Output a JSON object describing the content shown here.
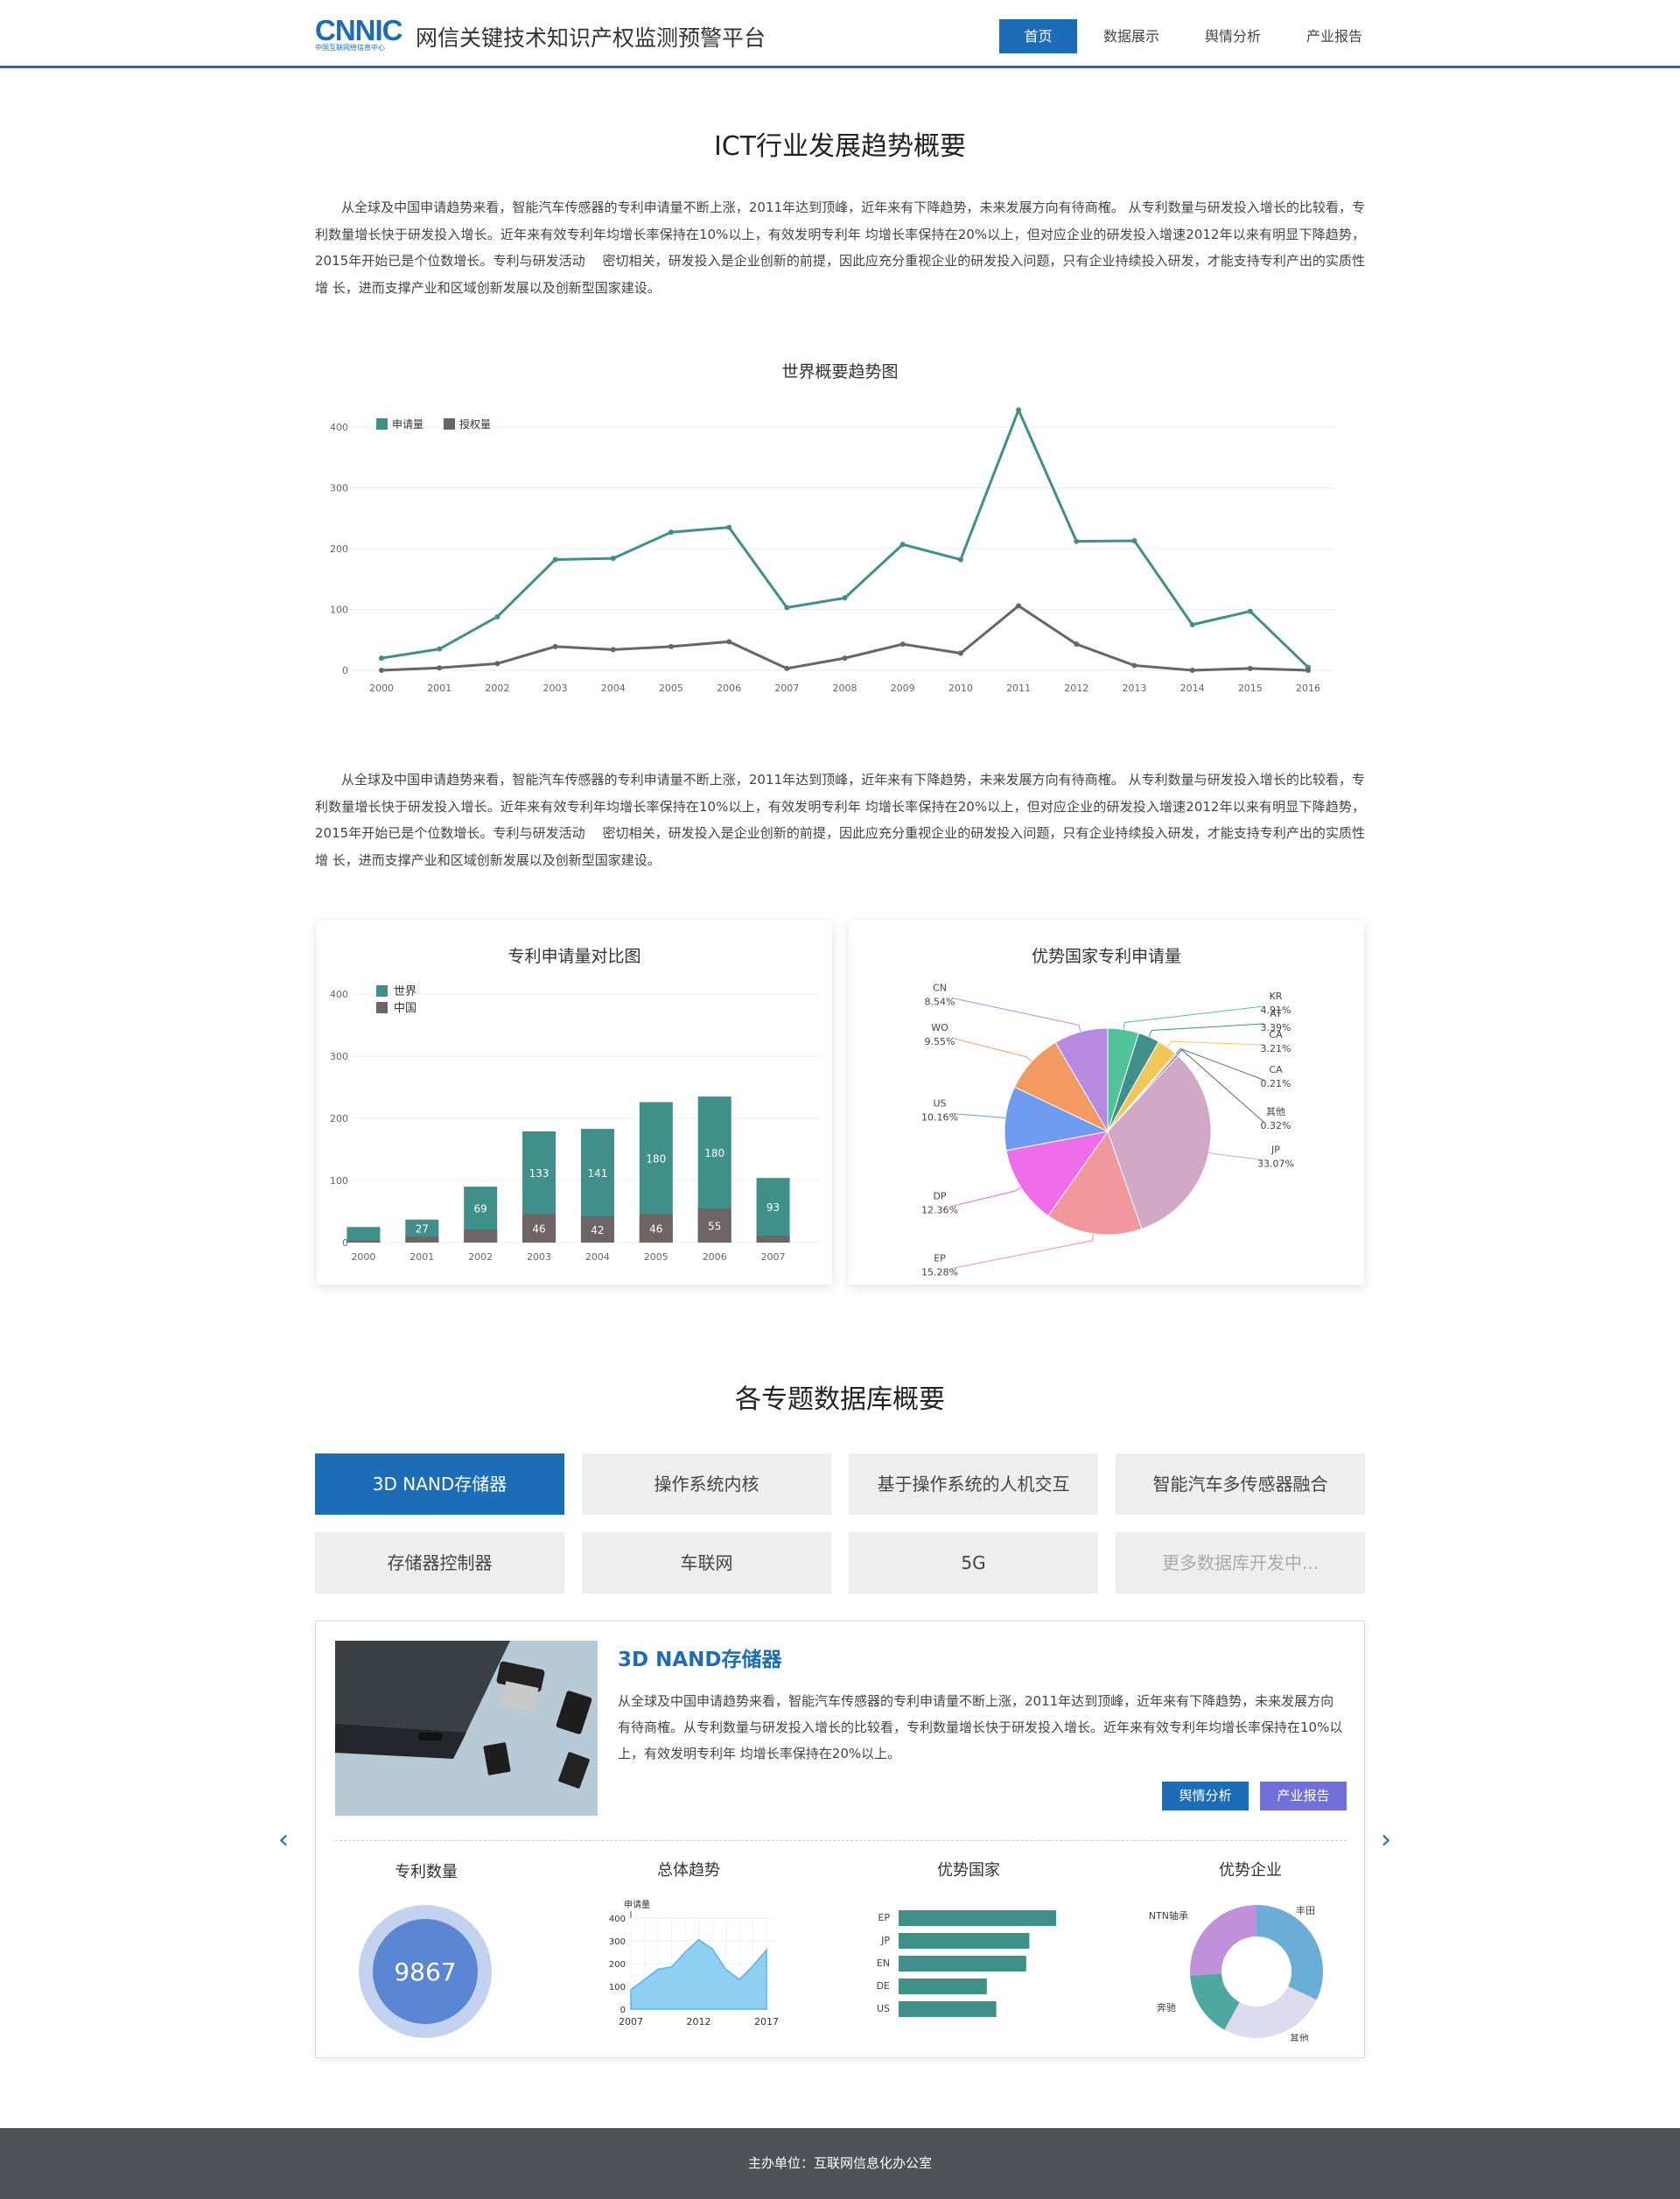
{
  "header": {
    "logo_text": "CNNIC",
    "logo_sub": "中国互联网络信息中心",
    "site_title": "网信关键技术知识产权监测预警平台",
    "nav": [
      "首页",
      "数据展示",
      "舆情分析",
      "产业报告"
    ]
  },
  "overview": {
    "title": "ICT行业发展趋势概要",
    "paragraph": "从全球及中国申请趋势来看，智能汽车传感器的专利申请量不断上涨，2011年达到顶峰，近年来有下降趋势，未来发展方向有待商榷。 从专利数量与研发投入增长的比较看，专利数量增长快于研发投入增长。近年来有效专利年均增长率保持在10%以上，有效发明专利年 均增长率保持在20%以上，但对应企业的研发投入增速2012年以来有明显下降趋势，2015年开始已是个位数增长。专利与研发活动 　密切相关，研发投入是企业创新的前提，因此应充分重视企业的研发投入问题，只有企业持续投入研发，才能支持专利产出的实质性增 长，进而支撑产业和区域创新发展以及创新型国家建设。",
    "paragraph2": "从全球及中国申请趋势来看，智能汽车传感器的专利申请量不断上涨，2011年达到顶峰，近年来有下降趋势，未来发展方向有待商榷。 从专利数量与研发投入增长的比较看，专利数量增长快于研发投入增长。近年来有效专利年均增长率保持在10%以上，有效发明专利年 均增长率保持在20%以上，但对应企业的研发投入增速2012年以来有明显下降趋势，2015年开始已是个位数增长。专利与研发活动 　密切相关，研发投入是企业创新的前提，因此应充分重视企业的研发投入问题，只有企业持续投入研发，才能支持专利产出的实质性增 长，进而支撑产业和区域创新发展以及创新型国家建设。"
  },
  "chart_data": [
    {
      "type": "line",
      "title": "世界概要趋势图",
      "x": [
        "2000",
        "2001",
        "2002",
        "2003",
        "2004",
        "2005",
        "2006",
        "2007",
        "2008",
        "2009",
        "2010",
        "2011",
        "2012",
        "2013",
        "2014",
        "2015",
        "2016"
      ],
      "ylim": [
        0,
        400
      ],
      "yticks": [
        0,
        100,
        200,
        300,
        400
      ],
      "legend_position": "top-left",
      "grid": true,
      "series": [
        {
          "name": "申请量",
          "color": "#3f9089",
          "values": [
            20,
            35,
            88,
            182,
            184,
            227,
            235,
            103,
            119,
            207,
            182,
            428,
            212,
            213,
            75,
            97,
            5
          ]
        },
        {
          "name": "授权量",
          "color": "#666666",
          "values": [
            0,
            4,
            11,
            39,
            34,
            39,
            47,
            3,
            20,
            43,
            28,
            106,
            43,
            8,
            0,
            3,
            0
          ]
        }
      ]
    },
    {
      "type": "bar",
      "title": "专利申请量对比图",
      "categories": [
        "2000",
        "2001",
        "2002",
        "2003",
        "2004",
        "2005",
        "2006",
        "2007"
      ],
      "ylim": [
        0,
        400
      ],
      "yticks": [
        0,
        100,
        200,
        300,
        400
      ],
      "legend_position": "top-left",
      "series": [
        {
          "name": "世界",
          "color": "#3f9089",
          "values": [
            25,
            37,
            90,
            179,
            183,
            226,
            235,
            104
          ],
          "labels": [
            "",
            "27",
            "69",
            "133",
            "141",
            "180",
            "180",
            "93"
          ]
        },
        {
          "name": "中国",
          "color": "#6f6465",
          "values": [
            3,
            10,
            21,
            46,
            42,
            46,
            55,
            11
          ],
          "labels": [
            "",
            "",
            "",
            "46",
            "42",
            "46",
            "55",
            ""
          ]
        }
      ]
    },
    {
      "type": "pie",
      "title": "优势国家专利申请量",
      "slices": [
        {
          "name": "KR",
          "value": 4.91,
          "label": "4.91%",
          "color": "#52c49a"
        },
        {
          "name": "AT",
          "value": 3.39,
          "label": "3.39%",
          "color": "#3f9089"
        },
        {
          "name": "CA",
          "value": 3.21,
          "label": "3.21%",
          "color": "#f2c75a"
        },
        {
          "name": "CA",
          "value": 0.21,
          "label": "0.21%",
          "color": "#4a72b8"
        },
        {
          "name": "其他",
          "value": 0.32,
          "label": "0.32%",
          "color": "#6b6464"
        },
        {
          "name": "JP",
          "value": 33.07,
          "label": "33.07%",
          "color": "#d1a9c7"
        },
        {
          "name": "EP",
          "value": 15.28,
          "label": "15.28%",
          "color": "#f0989c"
        },
        {
          "name": "DP",
          "value": 12.36,
          "label": "12.36%",
          "color": "#ef6de8"
        },
        {
          "name": "US",
          "value": 10.16,
          "label": "10.16%",
          "color": "#6f9cf0"
        },
        {
          "name": "WO",
          "value": 9.55,
          "label": "9.55%",
          "color": "#f39a62"
        },
        {
          "name": "CN",
          "value": 8.54,
          "label": "8.54%",
          "color": "#b68ae0"
        }
      ]
    },
    {
      "type": "area",
      "title": "总体趋势",
      "ylabel": "申请量",
      "yticks": [
        0,
        100,
        200,
        300,
        400
      ],
      "xticks": [
        "2007",
        "2012",
        "2017"
      ],
      "ylim": [
        0,
        400
      ],
      "x": [
        2007,
        2008,
        2009,
        2010,
        2011,
        2012,
        2013,
        2014,
        2015,
        2016,
        2017
      ],
      "values": [
        85,
        130,
        175,
        185,
        250,
        305,
        265,
        175,
        130,
        190,
        260
      ],
      "color": "#5bb2e8"
    },
    {
      "type": "bar",
      "title": "优势国家",
      "orientation": "horizontal",
      "categories": [
        "EP",
        "JP",
        "EN",
        "DE",
        "US"
      ],
      "values": [
        100,
        83,
        81,
        56,
        62
      ],
      "color": "#3f9089"
    },
    {
      "type": "pie",
      "title": "优势企业",
      "donut": true,
      "slices": [
        {
          "name": "丰田",
          "value": 32,
          "color": "#6aaed6"
        },
        {
          "name": "其他",
          "value": 26,
          "color": "#dcdcee"
        },
        {
          "name": "奔驰",
          "value": 16,
          "color": "#4da8a0"
        },
        {
          "name": "NTN轴承",
          "value": 26,
          "color": "#c090da"
        }
      ]
    }
  ],
  "databases": {
    "title": "各专题数据库概要",
    "tabs": [
      "3D NAND存储器",
      "操作系统内核",
      "基于操作系统的人机交互",
      "智能汽车多传感器融合",
      "存储器控制器",
      "车联网",
      "5G",
      "更多数据库开发中..."
    ],
    "detail": {
      "title": "3D NAND存储器",
      "text": "从全球及中国申请趋势来看，智能汽车传感器的专利申请量不断上涨，2011年达到顶峰，近年来有下降趋势，未来发展方向有待商榷。从专利数量与研发投入增长的比较看，专利数量增长快于研发投入增长。近年来有效专利年均增长率保持在10%以上，有效发明专利年 均增长率保持在20%以上。",
      "btn_sentiment": "舆情分析",
      "btn_report": "产业报告",
      "patent_count_title": "专利数量",
      "patent_count": "9867",
      "prev_icon": "chevron-left-icon",
      "next_icon": "chevron-right-icon"
    }
  },
  "footer": {
    "text": "主办单位：互联网信息化办公室"
  },
  "colors": {
    "primary": "#1c6cb8",
    "teal": "#3f9089",
    "footer_bg": "#505258",
    "report_btn": "#7070d8"
  }
}
